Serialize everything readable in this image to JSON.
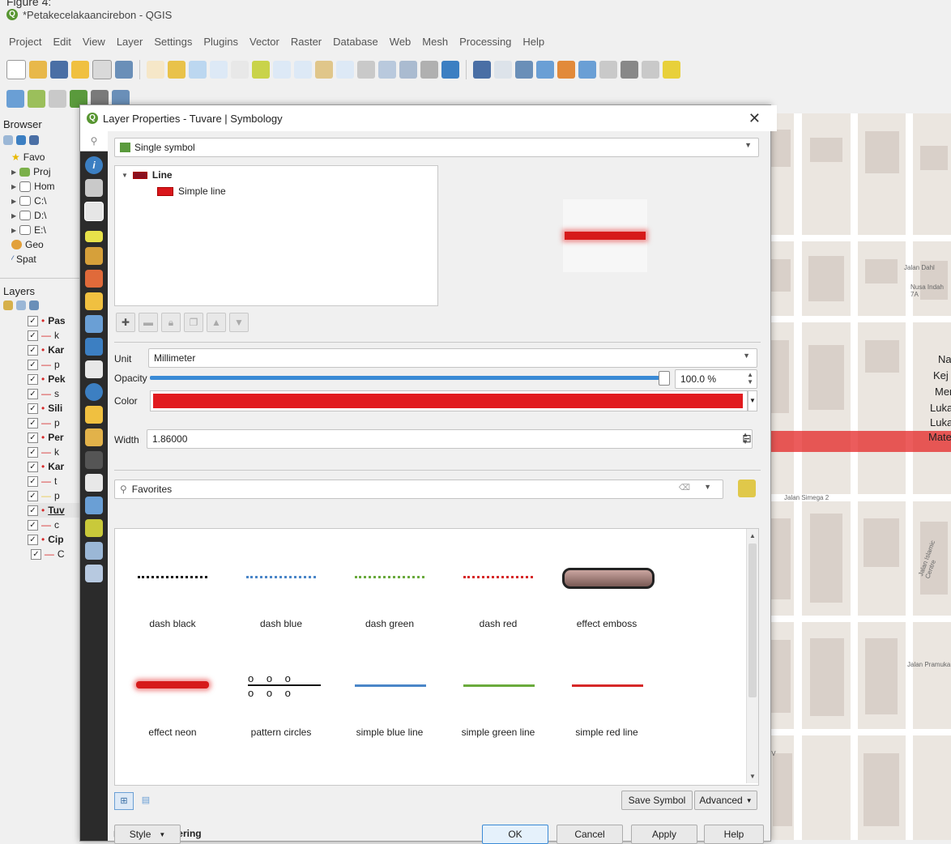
{
  "figure_label": "Figure 4:",
  "app": {
    "title": "*Petakecelakaancirebon - QGIS",
    "logo_letter": "Q"
  },
  "menu": [
    "Project",
    "Edit",
    "View",
    "Layer",
    "Settings",
    "Plugins",
    "Vector",
    "Raster",
    "Database",
    "Web",
    "Mesh",
    "Processing",
    "Help"
  ],
  "browser": {
    "title": "Browser",
    "items": [
      "Favo",
      "Proj",
      "Hom",
      "C:\\",
      "D:\\",
      "E:\\",
      "Geo",
      "Spat"
    ]
  },
  "layers": {
    "title": "Layers",
    "items": [
      {
        "label": "Pas",
        "bold": true
      },
      {
        "label": "k",
        "bold": false
      },
      {
        "label": "Kar",
        "bold": true
      },
      {
        "label": "p",
        "bold": false
      },
      {
        "label": "Pek",
        "bold": true
      },
      {
        "label": "s",
        "bold": false
      },
      {
        "label": "Sili",
        "bold": true
      },
      {
        "label": "p",
        "bold": false
      },
      {
        "label": "Per",
        "bold": true
      },
      {
        "label": "k",
        "bold": false
      },
      {
        "label": "Kar",
        "bold": true
      },
      {
        "label": "t",
        "bold": false
      },
      {
        "label": "p",
        "bold": false
      },
      {
        "label": "Tuv",
        "bold": true
      },
      {
        "label": "c",
        "bold": false
      },
      {
        "label": "Cip",
        "bold": true
      },
      {
        "label": "C",
        "bold": false
      }
    ]
  },
  "dialog": {
    "title": "Layer Properties - Tuvare | Symbology",
    "renderer": "Single symbol",
    "tree": {
      "root": "Line",
      "child": "Simple line"
    },
    "unit_label": "Unit",
    "unit_value": "Millimeter",
    "opacity_label": "Opacity",
    "opacity_value": "100.0 %",
    "opacity_fraction": 1.0,
    "color_label": "Color",
    "color_hex": "#e11b1f",
    "width_label": "Width",
    "width_value": "1.86000",
    "search_placeholder": "Favorites",
    "symbols": [
      {
        "label": "dash  black",
        "kind": "dash",
        "color": "#111111"
      },
      {
        "label": "dash blue",
        "kind": "dash",
        "color": "#4a86c8"
      },
      {
        "label": "dash green",
        "kind": "dash",
        "color": "#6aaa3c"
      },
      {
        "label": "dash red",
        "kind": "dash",
        "color": "#d62828"
      },
      {
        "label": "effect emboss",
        "kind": "emboss",
        "color": "#7a5a55"
      },
      {
        "label": "effect neon",
        "kind": "neon",
        "color": "#d61a1a"
      },
      {
        "label": "pattern circles",
        "kind": "circles",
        "color": "#111111"
      },
      {
        "label": "simple blue line",
        "kind": "solid",
        "color": "#4a86c8"
      },
      {
        "label": "simple green line",
        "kind": "solid",
        "color": "#6aaa3c"
      },
      {
        "label": "simple red line",
        "kind": "solid",
        "color": "#d62828"
      }
    ],
    "save_symbol": "Save Symbol",
    "advanced": "Advanced",
    "layer_rendering": "Layer Rendering",
    "style": "Style",
    "ok": "OK",
    "cancel": "Cancel",
    "apply": "Apply",
    "help": "Help"
  },
  "map_labels": {
    "jalan_dahl": "Jalan Dahl",
    "nusa": "Nusa Indah 7A",
    "na": "Na",
    "kej": "Kej",
    "mer": "Mer",
    "luka1": "Luka",
    "luka2": "Luka",
    "mate": "Mate",
    "simega": "Jalan Simega 2",
    "islamic": "Jalan Islamic Centre",
    "pramuka": "Jalan Pramuka",
    "iv": "IV"
  }
}
